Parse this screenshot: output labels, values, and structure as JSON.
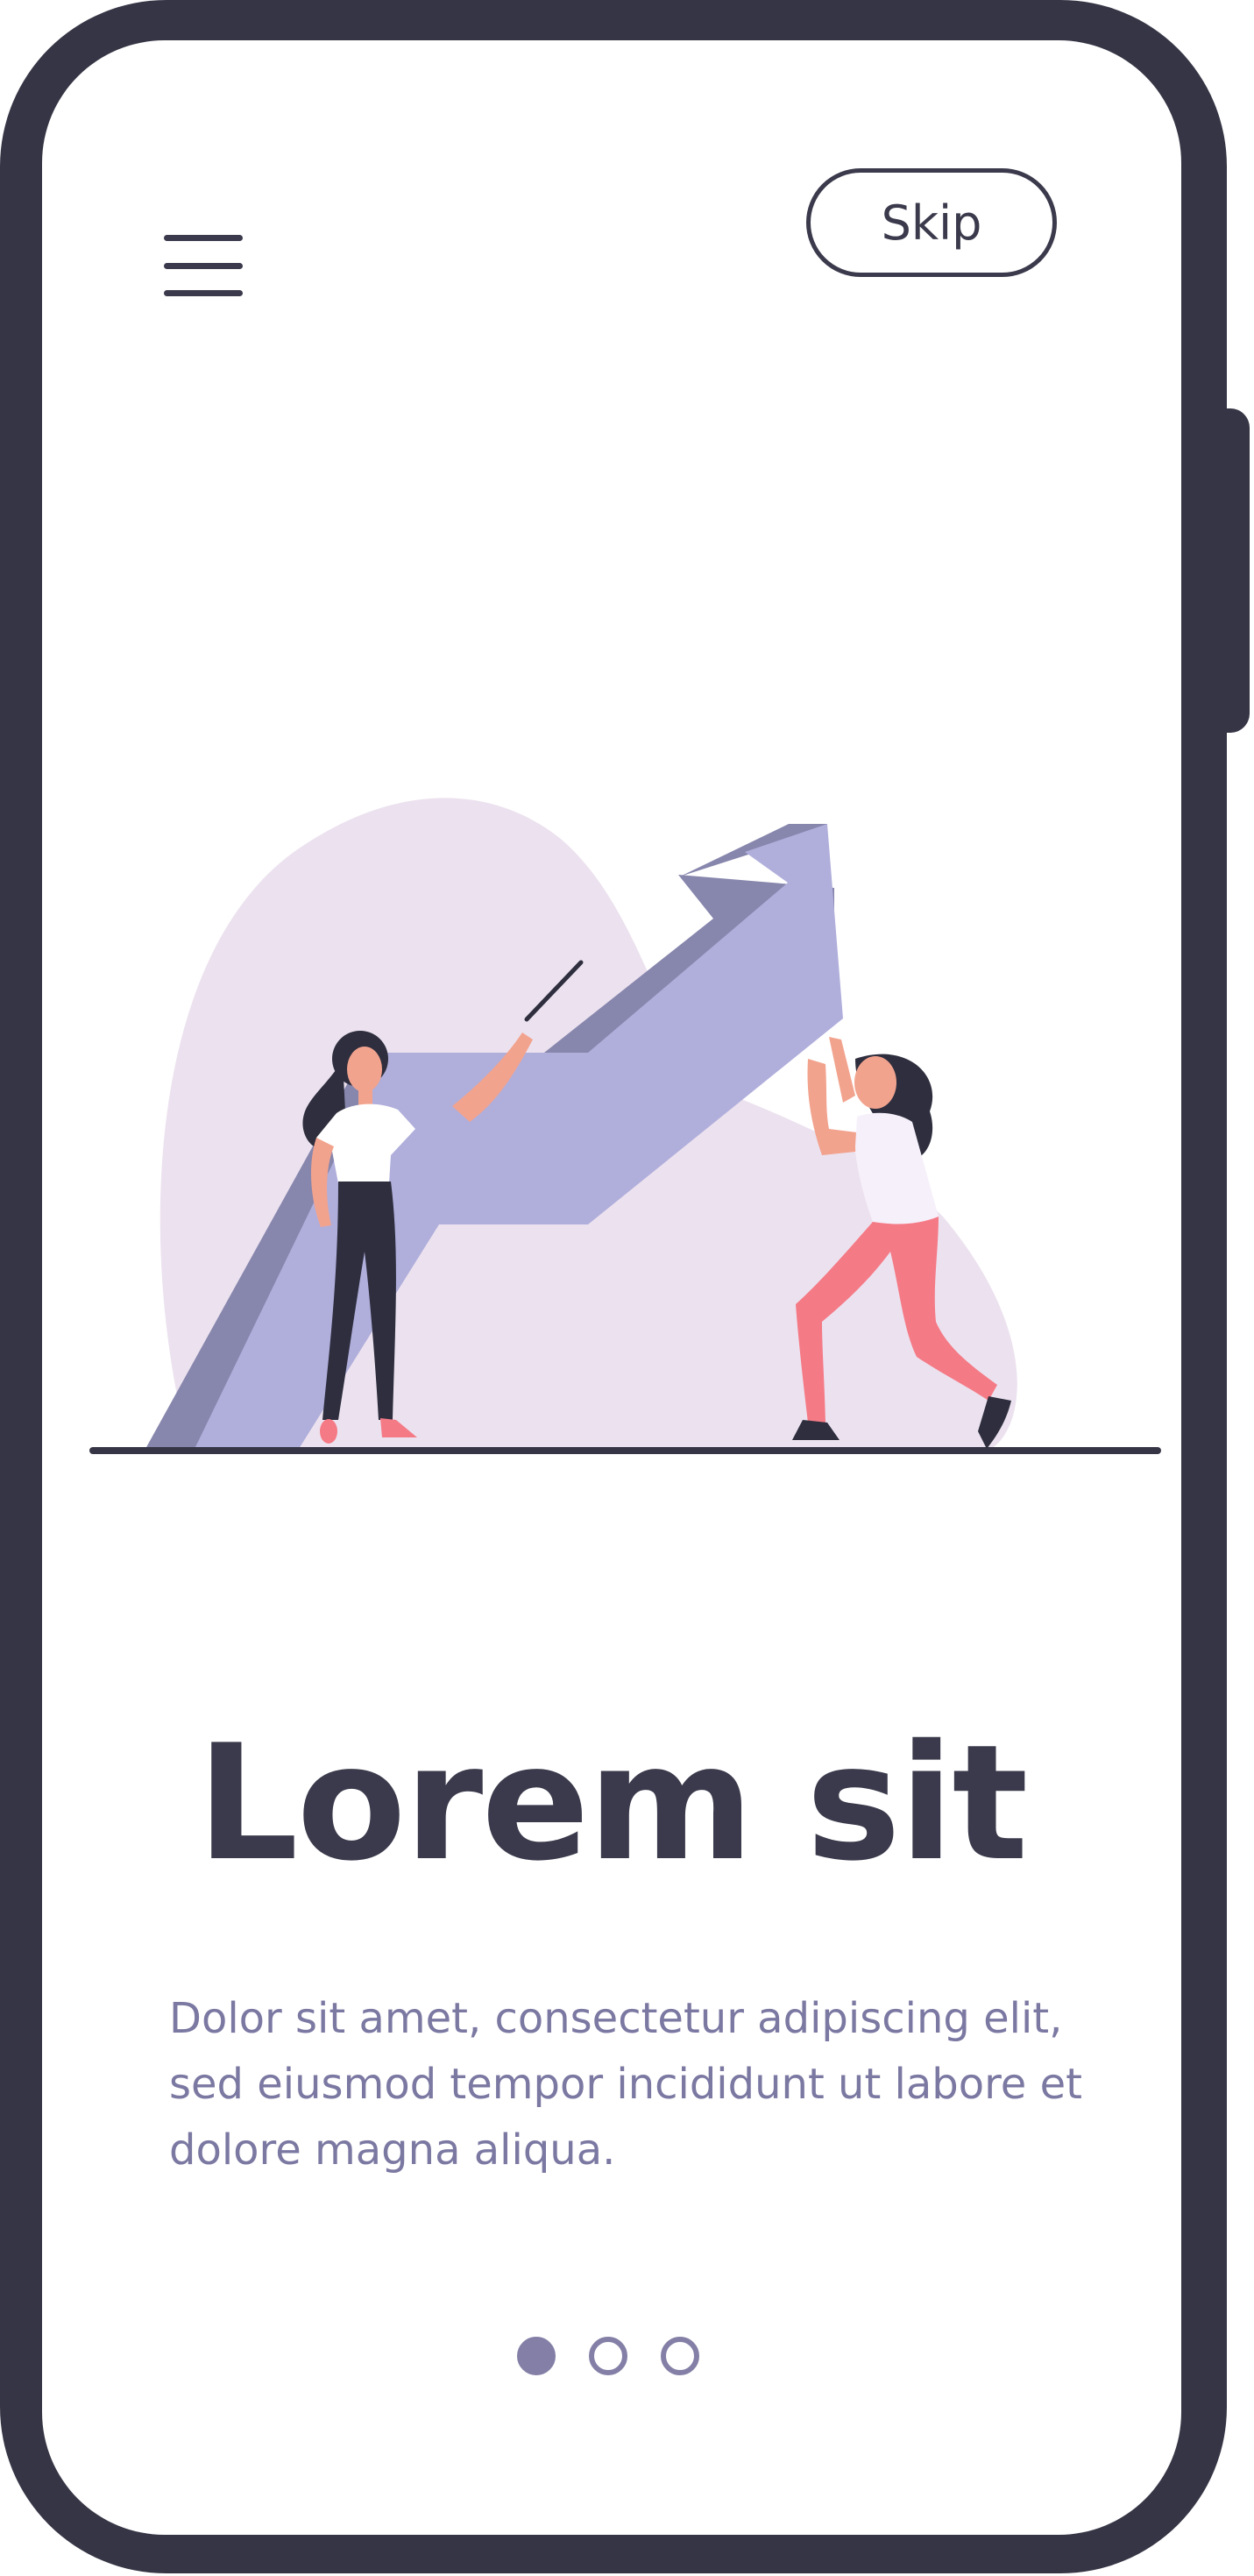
{
  "screen": {
    "skip_label": "Skip",
    "title": "Lorem sit",
    "description": "Dolor sit amet, consectetur adipiscing elit, sed eiusmod tempor incididunt ut labore et dolore magna aliqua."
  },
  "pager": {
    "total": 3,
    "active_index": 0
  },
  "icons": {
    "menu": "hamburger-menu-icon"
  },
  "colors": {
    "frame": "#353545",
    "text_dark": "#3a3a4c",
    "text_muted": "#7b78a2",
    "arrow": "#b0aedb",
    "arrow_shadow": "#8786ad",
    "blob": "#ece2ef",
    "accent_pink": "#f47a86",
    "dot": "#837fa6"
  }
}
